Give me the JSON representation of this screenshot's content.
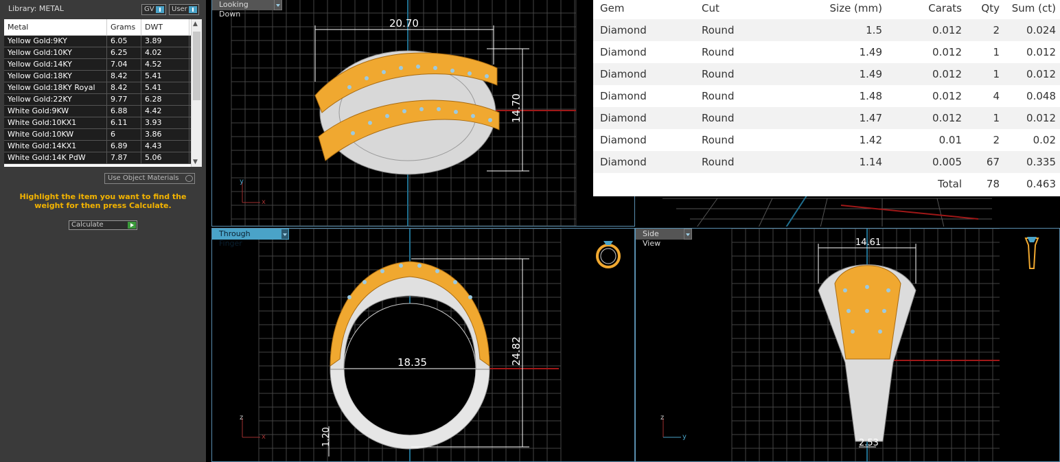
{
  "library": {
    "title": "Library: METAL",
    "toggle_gv": "GV",
    "toggle_user": "User",
    "columns": [
      "Metal",
      "Grams",
      "DWT"
    ],
    "rows": [
      [
        "Yellow Gold:9KY",
        "6.05",
        "3.89"
      ],
      [
        "Yellow Gold:10KY",
        "6.25",
        "4.02"
      ],
      [
        "Yellow Gold:14KY",
        "7.04",
        "4.52"
      ],
      [
        "Yellow Gold:18KY",
        "8.42",
        "5.41"
      ],
      [
        "Yellow Gold:18KY Royal",
        "8.42",
        "5.41"
      ],
      [
        "Yellow Gold:22KY",
        "9.77",
        "6.28"
      ],
      [
        "White Gold:9KW",
        "6.88",
        "4.42"
      ],
      [
        "White Gold:10KX1",
        "6.11",
        "3.93"
      ],
      [
        "White Gold:10KW",
        "6",
        "3.86"
      ],
      [
        "White Gold:14KX1",
        "6.89",
        "4.43"
      ],
      [
        "White Gold:14K PdW",
        "7.87",
        "5.06"
      ]
    ],
    "use_object_materials": "Use Object Materials",
    "hint": "Highlight the item you want to find the weight for then press Calculate.",
    "calculate": "Calculate"
  },
  "viewports": {
    "top_left": {
      "label": "Looking Down",
      "dim_width": "20.70",
      "dim_height": "14.70",
      "axis_a": "y",
      "axis_b": "x"
    },
    "bottom_left": {
      "label": "Through Finger",
      "dim_inner": "18.35",
      "dim_height": "24.82",
      "dim_band": "1.20",
      "axis_a": "z",
      "axis_b": "x"
    },
    "bottom_right": {
      "label": "Side View",
      "dim_top": "14.61",
      "dim_bottom": "2.53",
      "axis_a": "z",
      "axis_b": "y"
    }
  },
  "gem_table": {
    "headers": [
      "Gem",
      "Cut",
      "Size (mm)",
      "Carats",
      "Qty",
      "Sum (ct)"
    ],
    "rows": [
      [
        "Diamond",
        "Round",
        "1.5",
        "0.012",
        "2",
        "0.024"
      ],
      [
        "Diamond",
        "Round",
        "1.49",
        "0.012",
        "1",
        "0.012"
      ],
      [
        "Diamond",
        "Round",
        "1.49",
        "0.012",
        "1",
        "0.012"
      ],
      [
        "Diamond",
        "Round",
        "1.48",
        "0.012",
        "4",
        "0.048"
      ],
      [
        "Diamond",
        "Round",
        "1.47",
        "0.012",
        "1",
        "0.012"
      ],
      [
        "Diamond",
        "Round",
        "1.42",
        "0.01",
        "2",
        "0.02"
      ],
      [
        "Diamond",
        "Round",
        "1.14",
        "0.005",
        "67",
        "0.335"
      ]
    ],
    "total_label": "Total",
    "total_qty": "78",
    "total_sum": "0.463"
  },
  "colors": {
    "accent": "#4aa3c8",
    "gold": "#f0a830",
    "hint": "#f4b400",
    "panel": "#3a3a3a"
  }
}
